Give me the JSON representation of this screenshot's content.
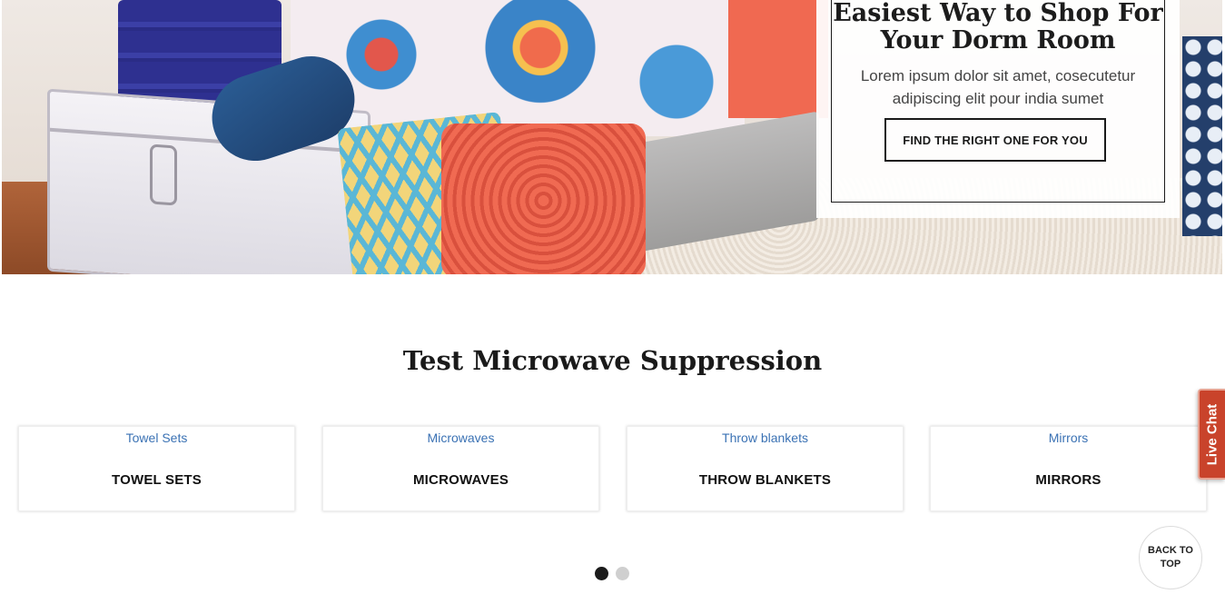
{
  "hero": {
    "title": "Easiest Way to Shop For Your Dorm Room",
    "subtitle": "Lorem ipsum dolor sit amet, cosecutetur adipiscing elit pour india sumet",
    "cta_label": "FIND THE RIGHT ONE FOR YOU"
  },
  "section": {
    "title": "Test Microwave Suppression"
  },
  "categories": [
    {
      "link": "Towel Sets",
      "title": "TOWEL SETS"
    },
    {
      "link": "Microwaves",
      "title": "MICROWAVES"
    },
    {
      "link": "Throw blankets",
      "title": "THROW BLANKETS"
    },
    {
      "link": "Mirrors",
      "title": "MIRRORS"
    }
  ],
  "carousel": {
    "pages": 2,
    "active": 1
  },
  "live_chat": {
    "label": "Live Chat"
  },
  "back_to_top": {
    "label": "BACK TO TOP"
  },
  "colors": {
    "link": "#3b72b4",
    "live_chat_bg": "#c9432b",
    "dot_active": "#1b1b1b",
    "dot_inactive": "#cfcfcf"
  }
}
